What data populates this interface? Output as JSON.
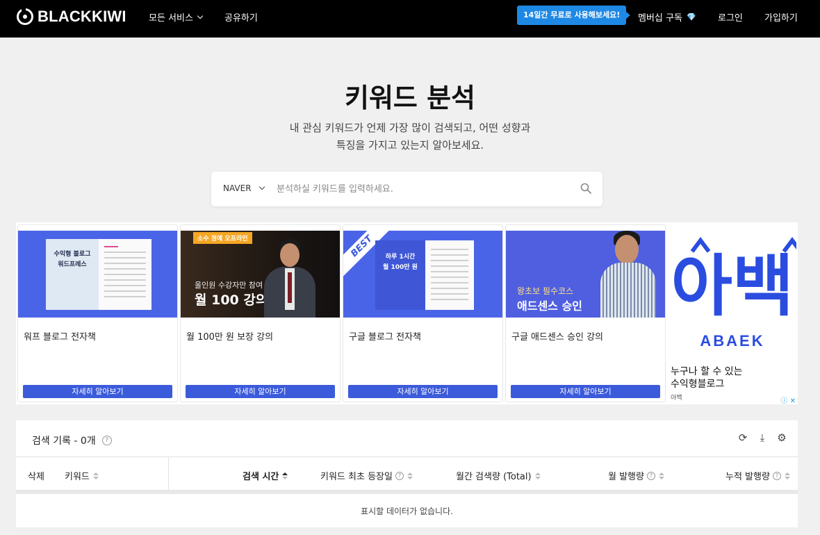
{
  "nav": {
    "logo": "BLACKKIWI",
    "all_services": "모든 서비스",
    "share": "공유하기",
    "promo": "14일간 무료로 사용해보세요!",
    "membership": "멤버십 구독",
    "login": "로그인",
    "signup": "가입하기"
  },
  "hero": {
    "title": "키워드 분석",
    "subtitle_line1": "내 관심 키워드가 언제 가장 많이 검색되고, 어떤 성향과",
    "subtitle_line2": "특징을 가지고 있는지 알아보세요."
  },
  "search": {
    "engine": "NAVER",
    "placeholder": "분석하실 키워드를 입력하세요."
  },
  "ads": {
    "cards": [
      {
        "title": "워프 블로그 전자책",
        "button": "자세히 알아보기",
        "img_title1": "수익형 블로그",
        "img_title2": "워드프레스"
      },
      {
        "title": "월 100만 원 보장 강의",
        "button": "자세히 알아보기",
        "tag": "소수 정예 오프라인",
        "img_line1": "올인원 수강자만 참여 가능",
        "img_line2": "월 100 강의"
      },
      {
        "title": "구글 블로그 전자책",
        "button": "자세히 알아보기",
        "badge": "BEST",
        "img_title1": "하루 1시간",
        "img_title2": "월 100만 원"
      },
      {
        "title": "구글 애드센스 승인 강의",
        "button": "자세히 알아보기",
        "img_line1": "왕초보 필수코스",
        "img_line2": "애드센스 승인"
      }
    ],
    "abaek": {
      "logo_text": "아백",
      "word": "ABAEK",
      "text_line1": "누구나 할 수 있는",
      "text_line2": "수익형블로그",
      "brand": "아백"
    }
  },
  "history": {
    "title": "검색 기록 - 0개",
    "columns": {
      "delete": "삭제",
      "keyword": "키워드",
      "search_time": "검색 시간",
      "first_seen": "키워드 최초 등장일",
      "monthly_volume": "월간 검색량 (Total)",
      "monthly_posts": "월 발행량",
      "total_posts": "누적 발행량"
    },
    "empty": "표시할 데이터가 없습니다."
  }
}
